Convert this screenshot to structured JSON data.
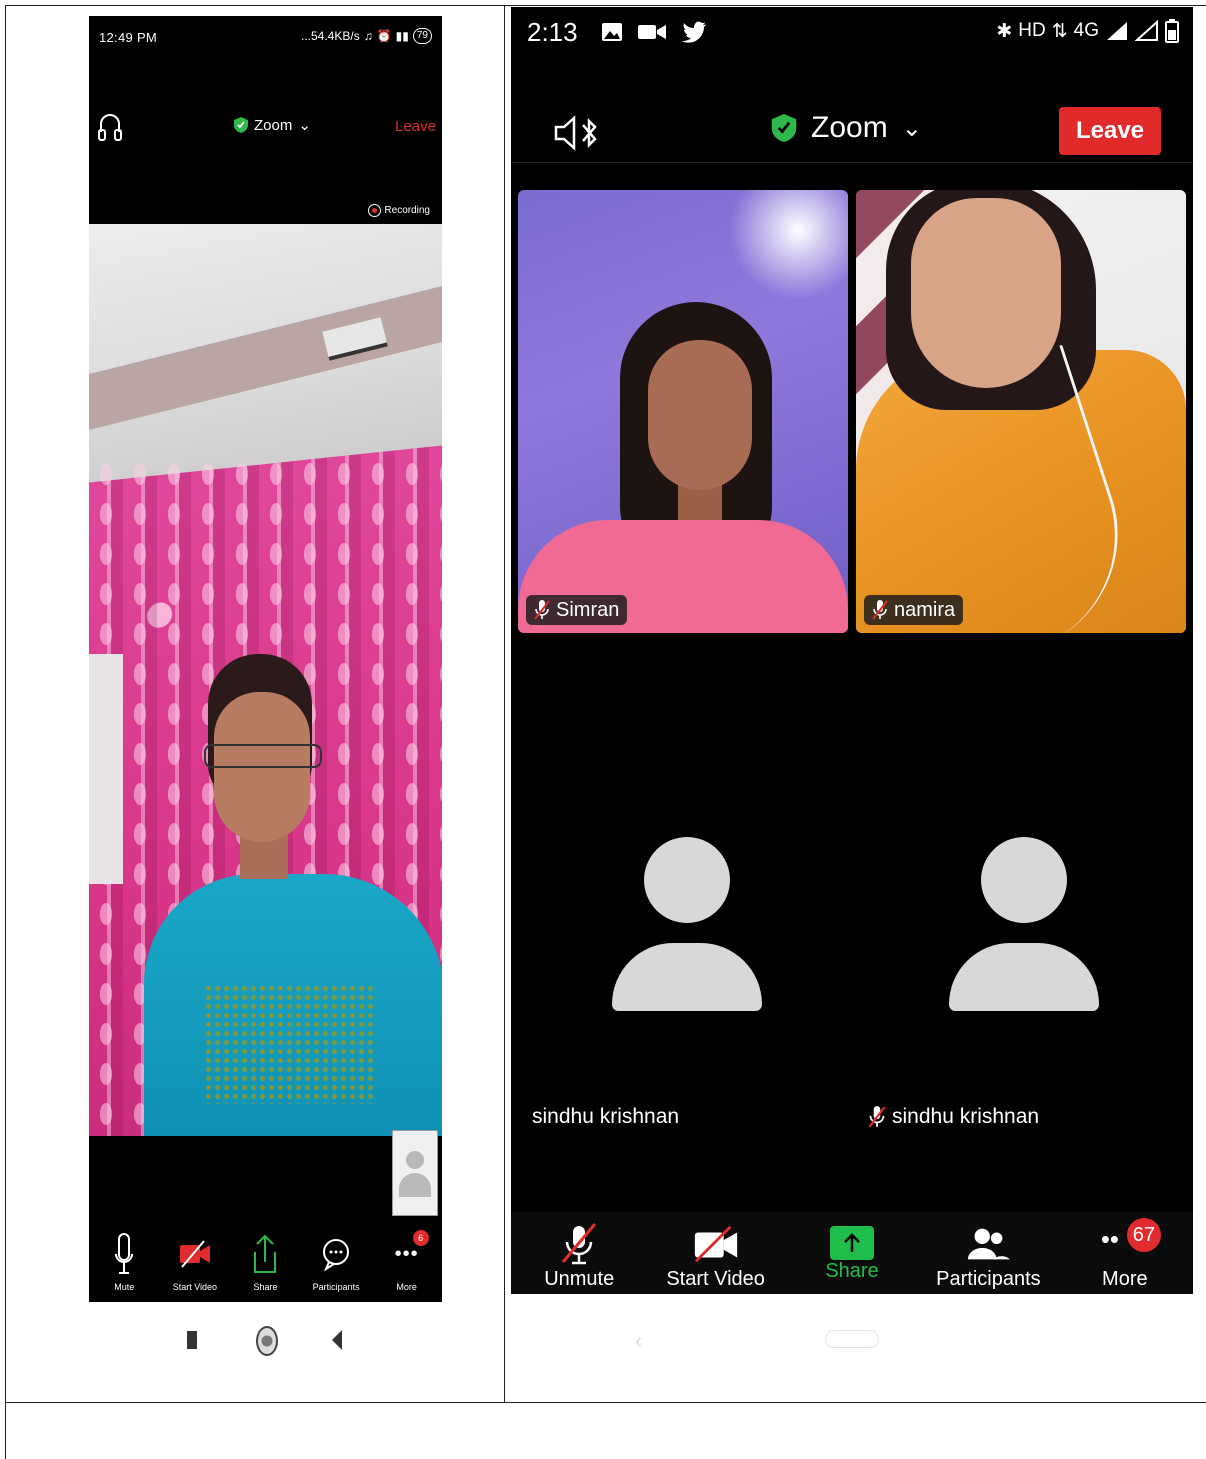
{
  "left_phone": {
    "status_time": "12:49 PM",
    "status_right": "...54.4KB/s",
    "battery": "79",
    "meeting_title": "Zoom",
    "leave_label": "Leave",
    "recording_label": "Recording",
    "more_badge": "6",
    "toolbar": [
      {
        "label": "Mute"
      },
      {
        "label": "Start Video"
      },
      {
        "label": "Share"
      },
      {
        "label": "Participants"
      },
      {
        "label": "More"
      }
    ]
  },
  "right_phone": {
    "status_time": "2:13",
    "status_right": "HD",
    "network": "4G",
    "meeting_title": "Zoom",
    "leave_label": "Leave",
    "tiles": [
      {
        "name": "Simran",
        "muted": true
      },
      {
        "name": "namira",
        "muted": true
      },
      {
        "name": "sindhu krishnan",
        "muted": false
      },
      {
        "name": "sindhu krishnan",
        "muted": true
      }
    ],
    "toolbar": [
      {
        "label": "Unmute"
      },
      {
        "label": "Start Video"
      },
      {
        "label": "Share"
      },
      {
        "label": "Participants"
      },
      {
        "label": "More"
      }
    ],
    "more_badge": "67"
  },
  "colors": {
    "leave_red": "#e22a2a",
    "share_green": "#1fbe4a",
    "shield_green": "#2fb84a",
    "background": "#000000"
  }
}
